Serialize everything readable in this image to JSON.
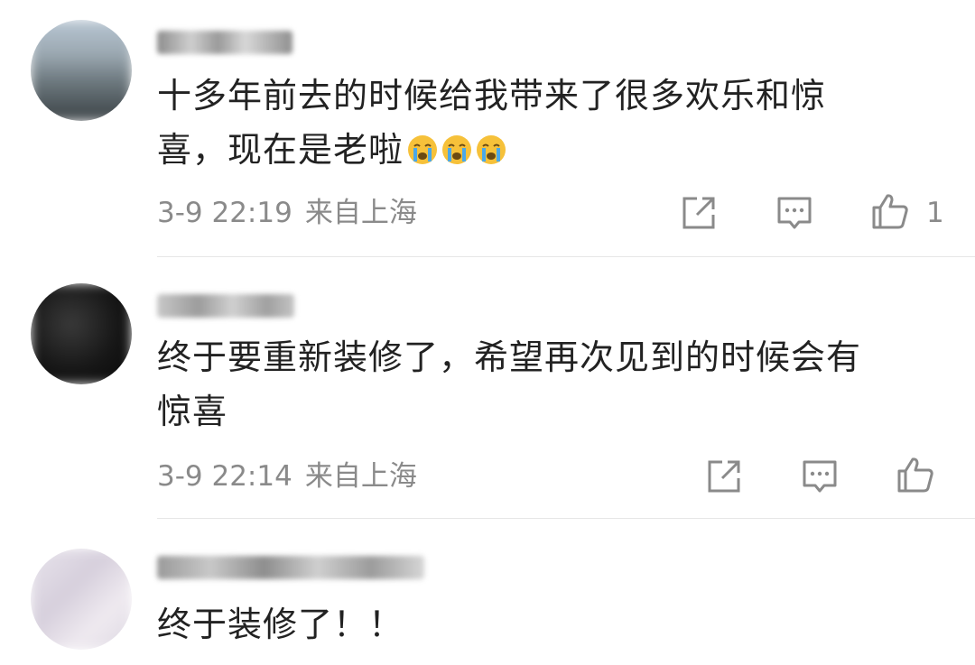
{
  "comments": [
    {
      "content_line1": "十多年前去的时候给我带来了很多欢乐和惊",
      "content_line2": "喜，现在是老啦",
      "emojis": [
        "crying-face-icon",
        "crying-face-icon",
        "crying-face-icon"
      ],
      "time": "3-9 22:19",
      "location": "来自上海",
      "like_count": "1"
    },
    {
      "content_line1": "终于要重新装修了，希望再次见到的时候会有",
      "content_line2": "惊喜",
      "time": "3-9 22:14",
      "location": "来自上海",
      "like_count": ""
    },
    {
      "content_line1": "终于装修了！！"
    }
  ],
  "icons": {
    "share": "share-icon",
    "reply": "comment-icon",
    "like": "thumbs-up-icon"
  },
  "colors": {
    "text": "#222222",
    "meta": "#8a8a8a",
    "divider": "#e6e6e6",
    "emoji": "#f6c13a"
  }
}
